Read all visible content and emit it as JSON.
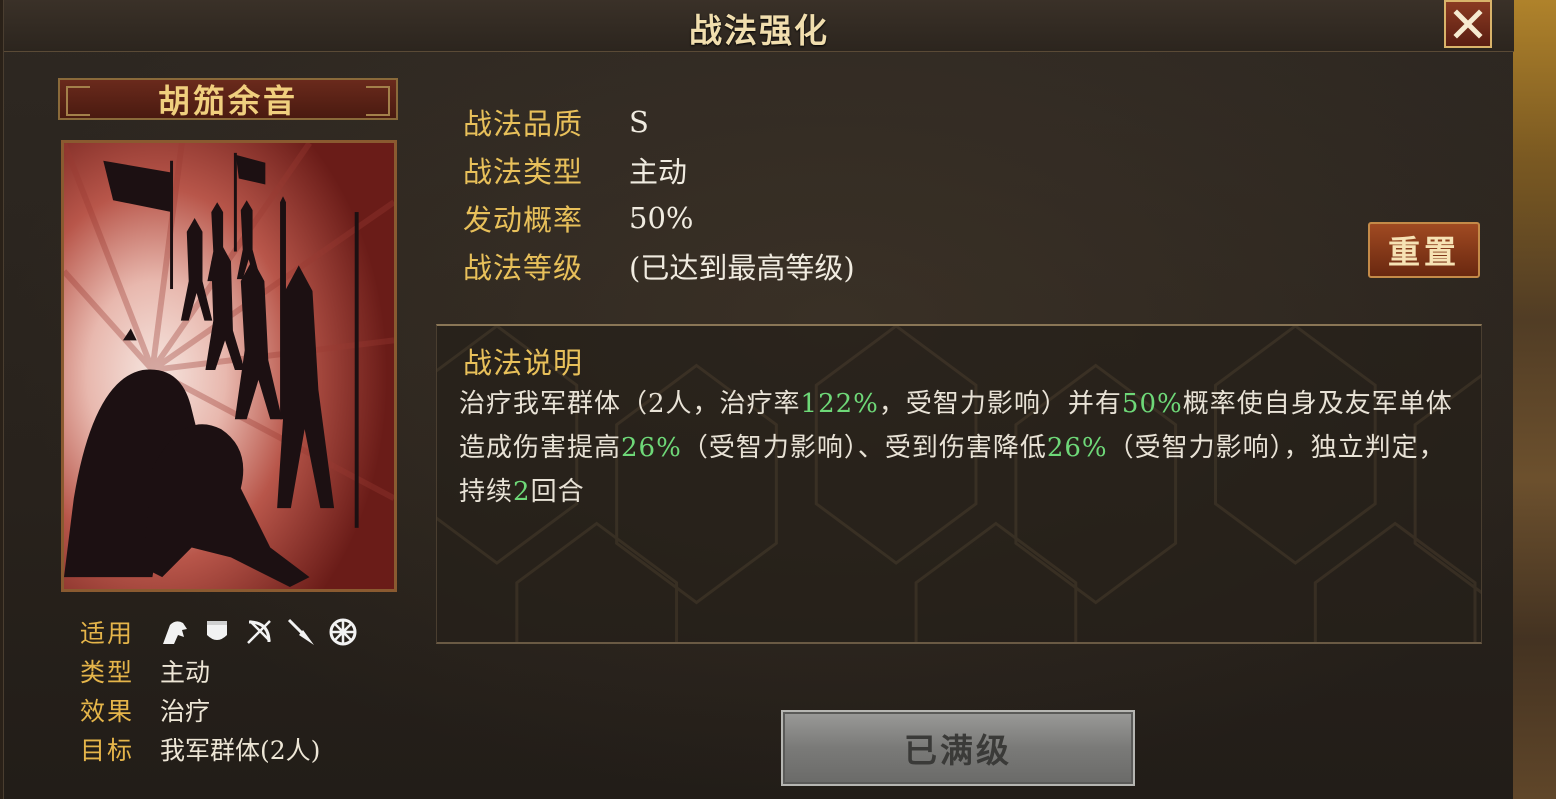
{
  "window": {
    "title": "战法强化"
  },
  "skill": {
    "name": "胡笳余音",
    "meta": {
      "applicable_label": "适用",
      "unit_icons": [
        "cavalry-icon",
        "shield-icon",
        "bow-icon",
        "spear-icon",
        "wheel-icon"
      ],
      "type_label": "类型",
      "type_value": "主动",
      "effect_label": "效果",
      "effect_value": "治疗",
      "target_label": "目标",
      "target_value": "我军群体(2人)"
    },
    "info": {
      "quality_label": "战法品质",
      "quality_value": "S",
      "kind_label": "战法类型",
      "kind_value": "主动",
      "rate_label": "发动概率",
      "rate_value": "50%",
      "level_label": "战法等级",
      "level_value": "(已达到最高等级)"
    },
    "description": {
      "title": "战法说明",
      "parts": [
        "治疗我军群体（2人，治疗率",
        "122%",
        "，受智力影响）并有",
        "50%",
        "概率使自身及友军单体造成伤害提高",
        "26%",
        "（受智力影响）、受到伤害降低",
        "26%",
        "（受智力影响），独立判定，持续",
        "2",
        "回合"
      ]
    }
  },
  "buttons": {
    "reset": "重置",
    "maxed": "已满级"
  },
  "colors": {
    "gold": "#e8c05a",
    "highlight": "#6ed878",
    "panel": "#2e2822"
  }
}
